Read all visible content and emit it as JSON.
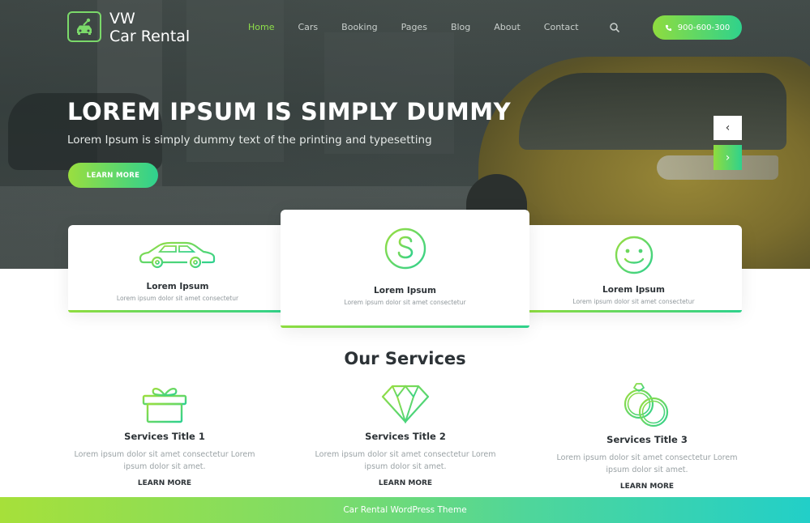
{
  "brand": {
    "line1": "VW",
    "line2": "Car Rental",
    "logo_icon": "car-key-icon"
  },
  "nav": {
    "items": [
      {
        "label": "Home",
        "active": true
      },
      {
        "label": "Cars",
        "active": false
      },
      {
        "label": "Booking",
        "active": false
      },
      {
        "label": "Pages",
        "active": false
      },
      {
        "label": "Blog",
        "active": false
      },
      {
        "label": "About",
        "active": false
      },
      {
        "label": "Contact",
        "active": false
      }
    ],
    "search_icon": "search-icon",
    "phone": "900-600-300",
    "phone_icon": "phone-icon"
  },
  "hero": {
    "title": "LOREM IPSUM IS SIMPLY DUMMY",
    "subtitle": "Lorem Ipsum is simply dummy text of the printing and typesetting",
    "button": "LEARN MORE",
    "prev": "‹",
    "next": "›"
  },
  "features": [
    {
      "icon": "car-icon",
      "title": "Lorem Ipsum",
      "desc": "Lorem ipsum dolor sit amet consectetur"
    },
    {
      "icon": "dollar-icon",
      "title": "Lorem Ipsum",
      "desc": "Lorem ipsum dolor sit amet consectetur"
    },
    {
      "icon": "smiley-icon",
      "title": "Lorem Ipsum",
      "desc": "Lorem ipsum dolor sit amet consectetur"
    }
  ],
  "services": {
    "heading": "Our Services",
    "items": [
      {
        "icon": "gift-icon",
        "title": "Services Title 1",
        "desc_line1": "Lorem ipsum dolor sit amet consectetur Lorem",
        "desc_line2": "ipsum dolor sit amet.",
        "link": "LEARN MORE"
      },
      {
        "icon": "diamond-icon",
        "title": "Services Title 2",
        "desc_line1": "Lorem ipsum dolor sit amet consectetur Lorem",
        "desc_line2": "ipsum dolor sit amet.",
        "link": "LEARN MORE"
      },
      {
        "icon": "rings-icon",
        "title": "Services Title 3",
        "desc_line1": "Lorem ipsum dolor sit amet consectetur Lorem",
        "desc_line2": "ipsum dolor sit amet.",
        "link": "LEARN MORE"
      }
    ]
  },
  "footer": {
    "text": "Car Rental WordPress Theme"
  },
  "colors": {
    "accent_start": "#8fdc3f",
    "accent_end": "#2fd28c",
    "nav_active": "#8fe04a",
    "heading": "#2c3236",
    "muted": "#9aa2a5"
  }
}
